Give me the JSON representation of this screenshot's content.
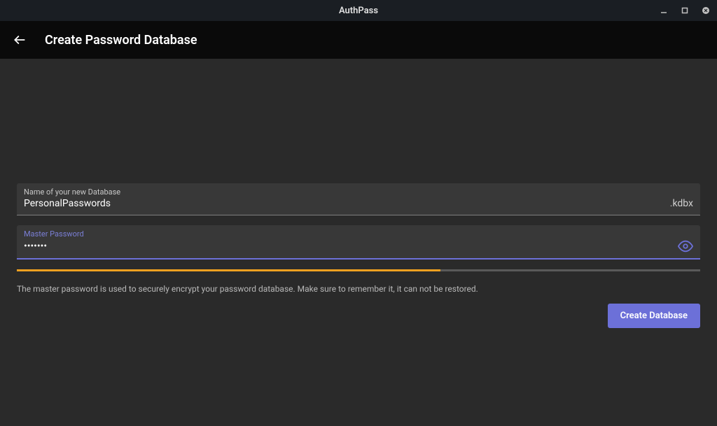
{
  "window": {
    "title": "AuthPass"
  },
  "appbar": {
    "title": "Create Password Database"
  },
  "fields": {
    "database_name": {
      "label": "Name of your new Database",
      "value": "PersonalPasswords",
      "suffix": ".kdbx"
    },
    "master_password": {
      "label": "Master Password",
      "value": "•••••••"
    }
  },
  "strength": {
    "percent": 62
  },
  "helper_text": "The master password is used to securely encrypt your password database. Make sure to remember it, it can not be restored.",
  "actions": {
    "create_label": "Create Database"
  }
}
